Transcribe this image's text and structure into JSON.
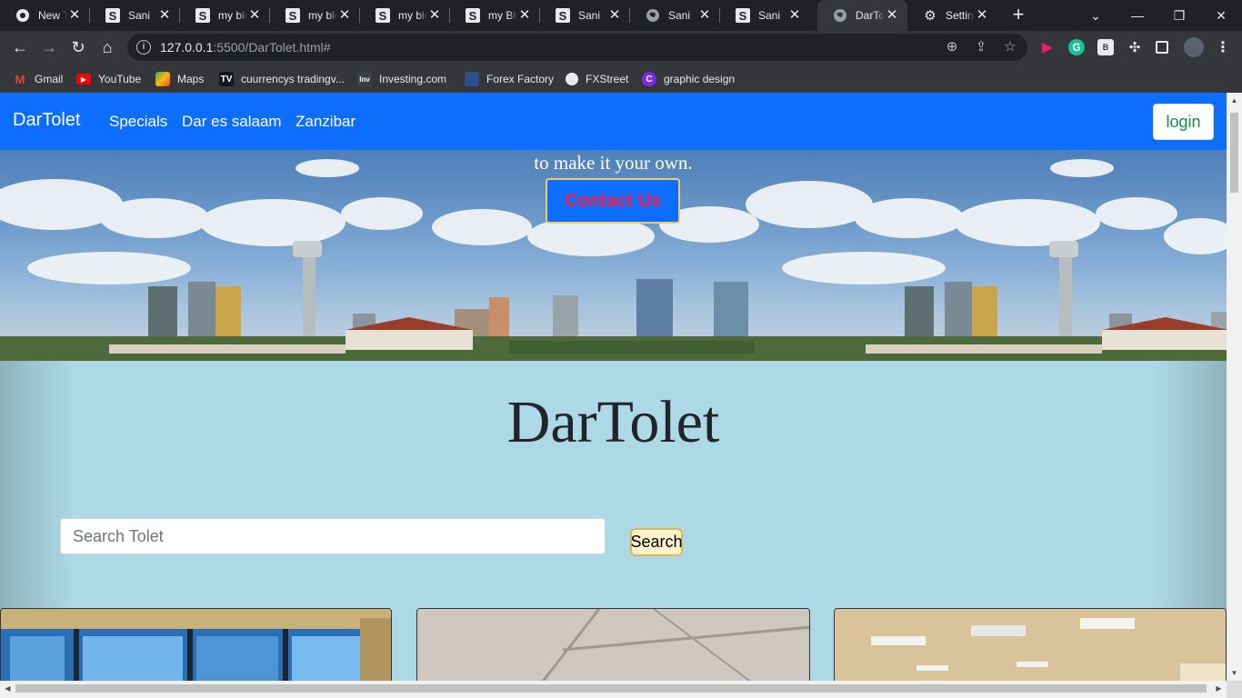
{
  "browser": {
    "tabs": [
      {
        "title": "New Tab",
        "icon": "chrome-icon"
      },
      {
        "title": "Sani",
        "icon": "s-icon"
      },
      {
        "title": "my blog",
        "icon": "s-icon"
      },
      {
        "title": "my blog",
        "icon": "s-icon"
      },
      {
        "title": "my blog",
        "icon": "s-icon"
      },
      {
        "title": "my Blog",
        "icon": "s-icon"
      },
      {
        "title": "Sani",
        "icon": "s-icon"
      },
      {
        "title": "Sani",
        "icon": "globe-icon"
      },
      {
        "title": "Sani",
        "icon": "s-icon"
      },
      {
        "title": "DarTolet",
        "icon": "globe-icon",
        "active": true
      },
      {
        "title": "Settings",
        "icon": "gear-icon"
      }
    ],
    "url_host": "127.0.0.1",
    "url_rest": ":5500/DarTolet.html#",
    "bookmarks": [
      {
        "label": "Gmail"
      },
      {
        "label": "YouTube"
      },
      {
        "label": "Maps"
      },
      {
        "label": "cuurrencys tradingv..."
      },
      {
        "label": "Investing.com"
      },
      {
        "label": "Forex Factory"
      },
      {
        "label": "FXStreet"
      },
      {
        "label": "graphic design"
      }
    ]
  },
  "site": {
    "nav": {
      "brand": "DarTolet",
      "links": [
        "Specials",
        "Dar es salaam",
        "Zanzibar"
      ],
      "login": "login"
    },
    "hero": {
      "tagline": "to make it your own.",
      "contact": "Contact Us"
    },
    "title": "DarTolet",
    "search": {
      "placeholder": "Search Tolet",
      "button": "Search"
    }
  },
  "colors": {
    "nav_bg": "#0d6efd",
    "page_bg": "#add8e6",
    "contact_text": "#ff1744",
    "login_text": "#198754"
  }
}
